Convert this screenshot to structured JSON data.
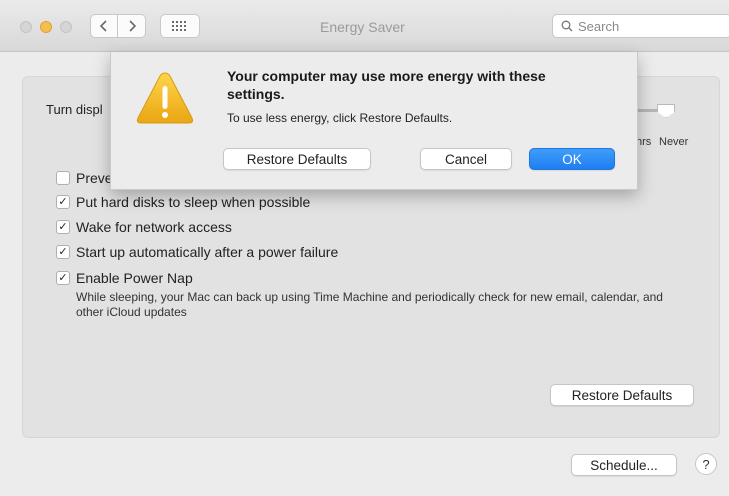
{
  "window": {
    "title": "Energy Saver",
    "search_placeholder": "Search"
  },
  "panel": {
    "turn_display_label": "Turn displ",
    "slider_ticks": [
      "hrs",
      "Never"
    ],
    "options": [
      {
        "label": "Preve",
        "checked": false
      },
      {
        "label": "Put hard disks to sleep when possible",
        "checked": true
      },
      {
        "label": "Wake for network access",
        "checked": true
      },
      {
        "label": "Start up automatically after a power failure",
        "checked": true
      },
      {
        "label": "Enable Power Nap",
        "checked": true
      }
    ],
    "power_nap_description": "While sleeping, your Mac can back up using Time Machine and periodically check for new email, calendar, and other iCloud updates",
    "restore_defaults_label": "Restore Defaults",
    "schedule_label": "Schedule...",
    "help_label": "?"
  },
  "alert": {
    "title": "Your computer may use more energy with these settings.",
    "message": "To use less energy, click Restore Defaults.",
    "restore_defaults_label": "Restore Defaults",
    "cancel_label": "Cancel",
    "ok_label": "OK"
  },
  "colors": {
    "accent": "#1f7ef2",
    "warning": "#f2b61f"
  }
}
